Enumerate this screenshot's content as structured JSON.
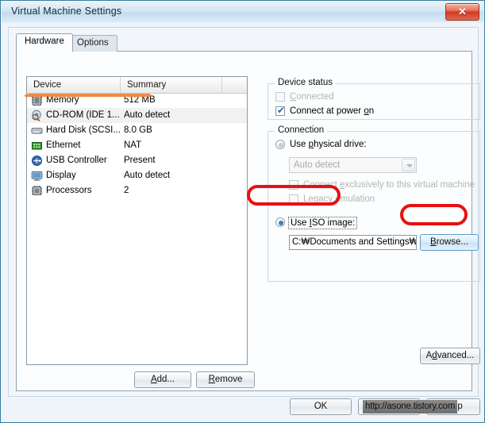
{
  "window": {
    "title": "Virtual Machine Settings",
    "close_label": "✕"
  },
  "tabs": [
    {
      "label": "Hardware",
      "active": true
    },
    {
      "label": "Options",
      "active": false
    }
  ],
  "device_list": {
    "columns": [
      "Device",
      "Summary",
      ""
    ],
    "rows": [
      {
        "icon": "memory-icon",
        "name": "Memory",
        "summary": "512 MB",
        "selected": false
      },
      {
        "icon": "cdrom-icon",
        "name": "CD-ROM (IDE 1...",
        "summary": "Auto detect",
        "selected": true
      },
      {
        "icon": "harddisk-icon",
        "name": "Hard Disk (SCSI...",
        "summary": "8.0 GB",
        "selected": false
      },
      {
        "icon": "ethernet-icon",
        "name": "Ethernet",
        "summary": "NAT",
        "selected": false
      },
      {
        "icon": "usb-icon",
        "name": "USB Controller",
        "summary": "Present",
        "selected": false
      },
      {
        "icon": "display-icon",
        "name": "Display",
        "summary": "Auto detect",
        "selected": false
      },
      {
        "icon": "processor-icon",
        "name": "Processors",
        "summary": "2",
        "selected": false
      }
    ]
  },
  "buttons": {
    "add": "Add...",
    "remove": "Remove",
    "advanced": "Advanced...",
    "browse": "Browse...",
    "ok": "OK",
    "cancel": "Cancel",
    "help": "Help"
  },
  "device_status": {
    "title": "Device status",
    "connected": {
      "label": "Connected",
      "checked": false,
      "enabled": false
    },
    "connect_at_power_on": {
      "label": "Connect at power on",
      "checked": true,
      "enabled": true
    }
  },
  "connection": {
    "title": "Connection",
    "use_physical_drive": {
      "label": "Use physical drive:",
      "selected": false
    },
    "physical_drive_value": "Auto detect",
    "connect_exclusively": {
      "label": "Connect exclusively to this virtual machine",
      "checked": false,
      "enabled": false
    },
    "legacy_emulation": {
      "label": "Legacy emulation",
      "checked": false,
      "enabled": false
    },
    "use_iso_image": {
      "label": "Use ISO image:",
      "selected": true
    },
    "iso_path_value": "C:₩Documents and Settings₩n."
  },
  "watermark": {
    "text": "http://asone.tistory.com"
  },
  "colors": {
    "annotation_red": "#e81010",
    "annotation_orange": "#ef8a4a",
    "accent_blue": "#3a7fc1"
  }
}
